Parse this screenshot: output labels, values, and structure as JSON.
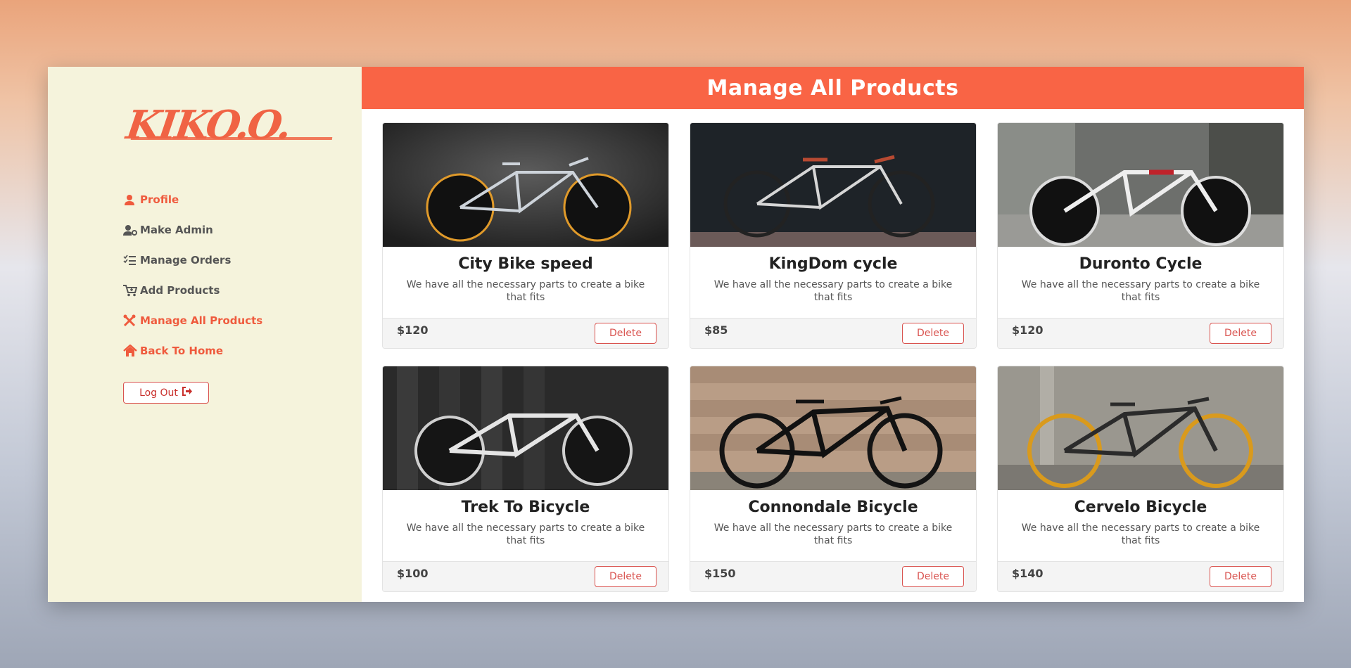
{
  "brand": {
    "logo_text": "KIKO.O."
  },
  "sidebar": {
    "items": [
      {
        "label": "Profile",
        "icon": "user-icon",
        "accent": true
      },
      {
        "label": "Make Admin",
        "icon": "user-cog-icon",
        "accent": false
      },
      {
        "label": "Manage Orders",
        "icon": "list-check-icon",
        "accent": false
      },
      {
        "label": "Add Products",
        "icon": "cart-plus-icon",
        "accent": false
      },
      {
        "label": "Manage All Products",
        "icon": "tools-icon",
        "accent": true
      },
      {
        "label": "Back To Home",
        "icon": "home-icon",
        "accent": true
      }
    ],
    "logout_label": "Log Out"
  },
  "main": {
    "title": "Manage All Products",
    "delete_label": "Delete",
    "products": [
      {
        "name": "City Bike speed",
        "description": "We have all the necessary parts to create a bike that fits",
        "price": "$120"
      },
      {
        "name": "KingDom cycle",
        "description": "We have all the necessary parts to create a bike that fits",
        "price": "$85"
      },
      {
        "name": "Duronto Cycle",
        "description": "We have all the necessary parts to create a bike that fits",
        "price": "$120"
      },
      {
        "name": "Trek To Bicycle",
        "description": "We have all the necessary parts to create a bike that fits",
        "price": "$100"
      },
      {
        "name": "Connondale Bicycle",
        "description": "We have all the necessary parts to create a bike that fits",
        "price": "$150"
      },
      {
        "name": "Cervelo Bicycle",
        "description": "We have all the necessary parts to create a bike that fits",
        "price": "$140"
      }
    ]
  },
  "colors": {
    "accent": "#f96445",
    "sidebar_bg": "#f5f3dc",
    "danger": "#d9534f"
  }
}
